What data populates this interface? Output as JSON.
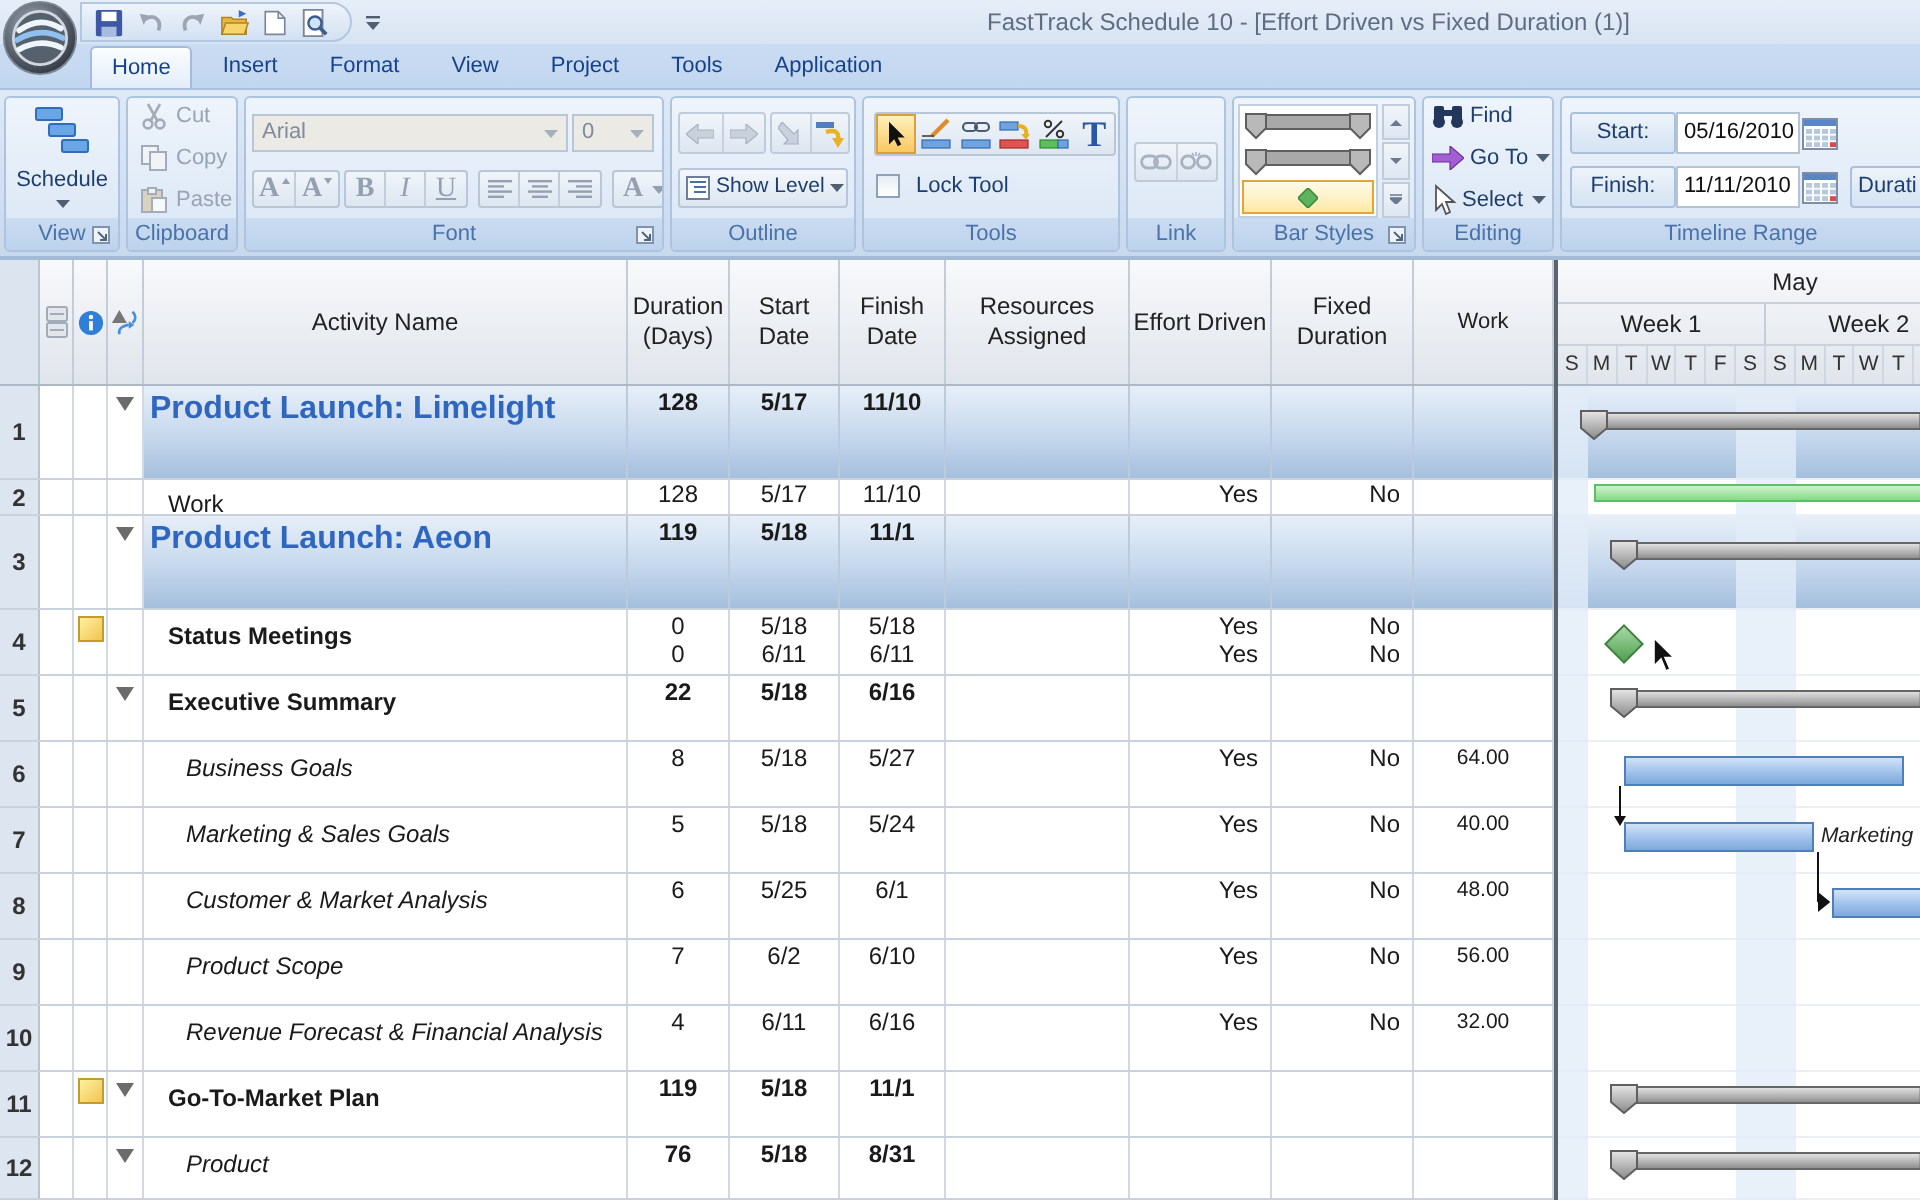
{
  "window": {
    "title": "FastTrack Schedule 10 - [Effort Driven vs Fixed Duration (1)]"
  },
  "ribbon_tabs": [
    {
      "label": "Home",
      "selected": true
    },
    {
      "label": "Insert",
      "selected": false
    },
    {
      "label": "Format",
      "selected": false
    },
    {
      "label": "View",
      "selected": false
    },
    {
      "label": "Project",
      "selected": false
    },
    {
      "label": "Tools",
      "selected": false
    },
    {
      "label": "Application",
      "selected": false
    }
  ],
  "ribbon": {
    "view_group": {
      "label": "View",
      "schedule_button": "Schedule"
    },
    "clipboard_group": {
      "label": "Clipboard",
      "buttons": [
        {
          "kind": "cut",
          "label": "Cut",
          "disabled": true
        },
        {
          "kind": "copy",
          "label": "Copy",
          "disabled": true
        },
        {
          "kind": "paste",
          "label": "Paste",
          "disabled": true
        }
      ]
    },
    "font_group": {
      "label": "Font",
      "disabled": true,
      "font_name": "Arial",
      "font_size": "0",
      "format_button_groups": [
        [
          {
            "kind": "grow",
            "label": "A"
          },
          {
            "kind": "shrink",
            "label": "A"
          }
        ],
        [
          {
            "kind": "bold",
            "label": "B"
          },
          {
            "kind": "italic",
            "label": "I"
          },
          {
            "kind": "underline",
            "label": "U"
          }
        ],
        [
          {
            "kind": "align_left"
          },
          {
            "kind": "align_center"
          },
          {
            "kind": "align_right"
          }
        ],
        [
          {
            "kind": "font_color",
            "label": "A"
          }
        ]
      ]
    },
    "outline_group": {
      "label": "Outline",
      "show_level_button": "Show Level"
    },
    "tools_group": {
      "label": "Tools",
      "tools": [
        {
          "kind": "pointer",
          "selected": true
        },
        {
          "kind": "draw_bar",
          "selected": false
        },
        {
          "kind": "link_bars",
          "selected": false
        },
        {
          "kind": "move_bar",
          "selected": false
        },
        {
          "kind": "percent_complete",
          "selected": false
        },
        {
          "kind": "text",
          "label": "T",
          "selected": false
        }
      ],
      "lock_tool": {
        "label": "Lock Tool",
        "checked": false
      }
    },
    "link_group": {
      "label": "Link"
    },
    "bar_styles_group": {
      "label": "Bar Styles",
      "styles": [
        {
          "kind": "summary",
          "selected": false
        },
        {
          "kind": "summary",
          "selected": false
        },
        {
          "kind": "milestone",
          "selected": true
        }
      ]
    },
    "editing_group": {
      "label": "Editing",
      "buttons": [
        {
          "kind": "find",
          "label": "Find",
          "dropdown": false
        },
        {
          "kind": "go_to",
          "label": "Go To",
          "dropdown": true
        },
        {
          "kind": "select",
          "label": "Select",
          "dropdown": true
        }
      ]
    },
    "timeline_range_group": {
      "label": "Timeline Range",
      "start_button": "Start:",
      "start_value": "05/16/2010",
      "finish_button": "Finish:",
      "finish_value": "11/11/2010",
      "duration_button": "Durati"
    }
  },
  "table": {
    "columns": [
      "Activity Name",
      "Duration (Days)",
      "Start Date",
      "Finish Date",
      "Resources Assigned",
      "Effort Driven",
      "Fixed Duration",
      "Work"
    ],
    "rows": [
      {
        "number": "1",
        "kind": "project",
        "name": "Product Launch: Limelight",
        "note": false,
        "expanded": true,
        "duration": "128",
        "start": "5/17",
        "finish": "11/10",
        "gantt_bar": {
          "kind": "summary"
        },
        "children": [
          {
            "number": "2",
            "kind": "task",
            "name": "Work",
            "note": false,
            "duration": "128",
            "start": "5/17",
            "finish": "11/10",
            "effort_driven": "Yes",
            "fixed_duration": "No",
            "gantt_bar": {
              "kind": "work"
            }
          }
        ]
      },
      {
        "number": "3",
        "kind": "project",
        "name": "Product Launch: Aeon",
        "note": false,
        "expanded": true,
        "duration": "119",
        "start": "5/18",
        "finish": "11/1",
        "gantt_bar": {
          "kind": "summary"
        },
        "children": [
          {
            "number": "4",
            "kind": "recurring",
            "name": "Status Meetings",
            "note": true,
            "occurrences": [
              {
                "duration": "0",
                "start": "5/18",
                "finish": "5/18",
                "effort_driven": "Yes",
                "fixed_duration": "No"
              },
              {
                "duration": "0",
                "start": "6/11",
                "finish": "6/11",
                "effort_driven": "Yes",
                "fixed_duration": "No"
              }
            ],
            "gantt_bar": {
              "kind": "milestone"
            }
          },
          {
            "number": "5",
            "kind": "summary",
            "name": "Executive Summary",
            "note": false,
            "expanded": true,
            "duration": "22",
            "start": "5/18",
            "finish": "6/16",
            "gantt_bar": {
              "kind": "summary"
            },
            "children": [
              {
                "number": "6",
                "kind": "task",
                "name": "Business Goals",
                "note": false,
                "duration": "8",
                "start": "5/18",
                "finish": "5/27",
                "effort_driven": "Yes",
                "fixed_duration": "No",
                "work": "64.00",
                "gantt_bar": {
                  "kind": "task"
                }
              },
              {
                "number": "7",
                "kind": "task",
                "name": "Marketing & Sales Goals",
                "note": false,
                "duration": "5",
                "start": "5/18",
                "finish": "5/24",
                "effort_driven": "Yes",
                "fixed_duration": "No",
                "work": "40.00",
                "gantt_bar": {
                  "kind": "task",
                  "label": "Marketing"
                },
                "predecessor_link": {
                  "kind": "start_to_start"
                }
              },
              {
                "number": "8",
                "kind": "task",
                "name": "Customer & Market Analysis",
                "note": false,
                "duration": "6",
                "start": "5/25",
                "finish": "6/1",
                "effort_driven": "Yes",
                "fixed_duration": "No",
                "work": "48.00",
                "gantt_bar": {
                  "kind": "task"
                },
                "predecessor_link": {
                  "kind": "finish_to_start"
                }
              },
              {
                "number": "9",
                "kind": "task",
                "name": "Product Scope",
                "note": false,
                "duration": "7",
                "start": "6/2",
                "finish": "6/10",
                "effort_driven": "Yes",
                "fixed_duration": "No",
                "work": "56.00"
              },
              {
                "number": "10",
                "kind": "task",
                "name": "Revenue Forecast & Financial Analysis",
                "note": false,
                "duration": "4",
                "start": "6/11",
                "finish": "6/16",
                "effort_driven": "Yes",
                "fixed_duration": "No",
                "work": "32.00"
              }
            ]
          },
          {
            "number": "11",
            "kind": "summary",
            "name": "Go-To-Market Plan",
            "note": true,
            "expanded": true,
            "duration": "119",
            "start": "5/18",
            "finish": "11/1",
            "gantt_bar": {
              "kind": "summary"
            },
            "children": [
              {
                "number": "12",
                "kind": "summary",
                "name": "Product",
                "note": false,
                "expanded": true,
                "duration": "76",
                "start": "5/18",
                "finish": "8/31",
                "gantt_bar": {
                  "kind": "summary"
                }
              }
            ]
          }
        ]
      }
    ]
  },
  "gantt": {
    "month": "May",
    "weeks": [
      "Week 1",
      "Week 2"
    ],
    "days": [
      {
        "label": "S",
        "nonworking": true
      },
      {
        "label": "M",
        "nonworking": false
      },
      {
        "label": "T",
        "nonworking": false
      },
      {
        "label": "W",
        "nonworking": false
      },
      {
        "label": "T",
        "nonworking": false
      },
      {
        "label": "F",
        "nonworking": false
      },
      {
        "label": "S",
        "nonworking": true
      },
      {
        "label": "S",
        "nonworking": true
      },
      {
        "label": "M",
        "nonworking": false
      },
      {
        "label": "T",
        "nonworking": false
      },
      {
        "label": "W",
        "nonworking": false
      },
      {
        "label": "T",
        "nonworking": false
      }
    ]
  }
}
